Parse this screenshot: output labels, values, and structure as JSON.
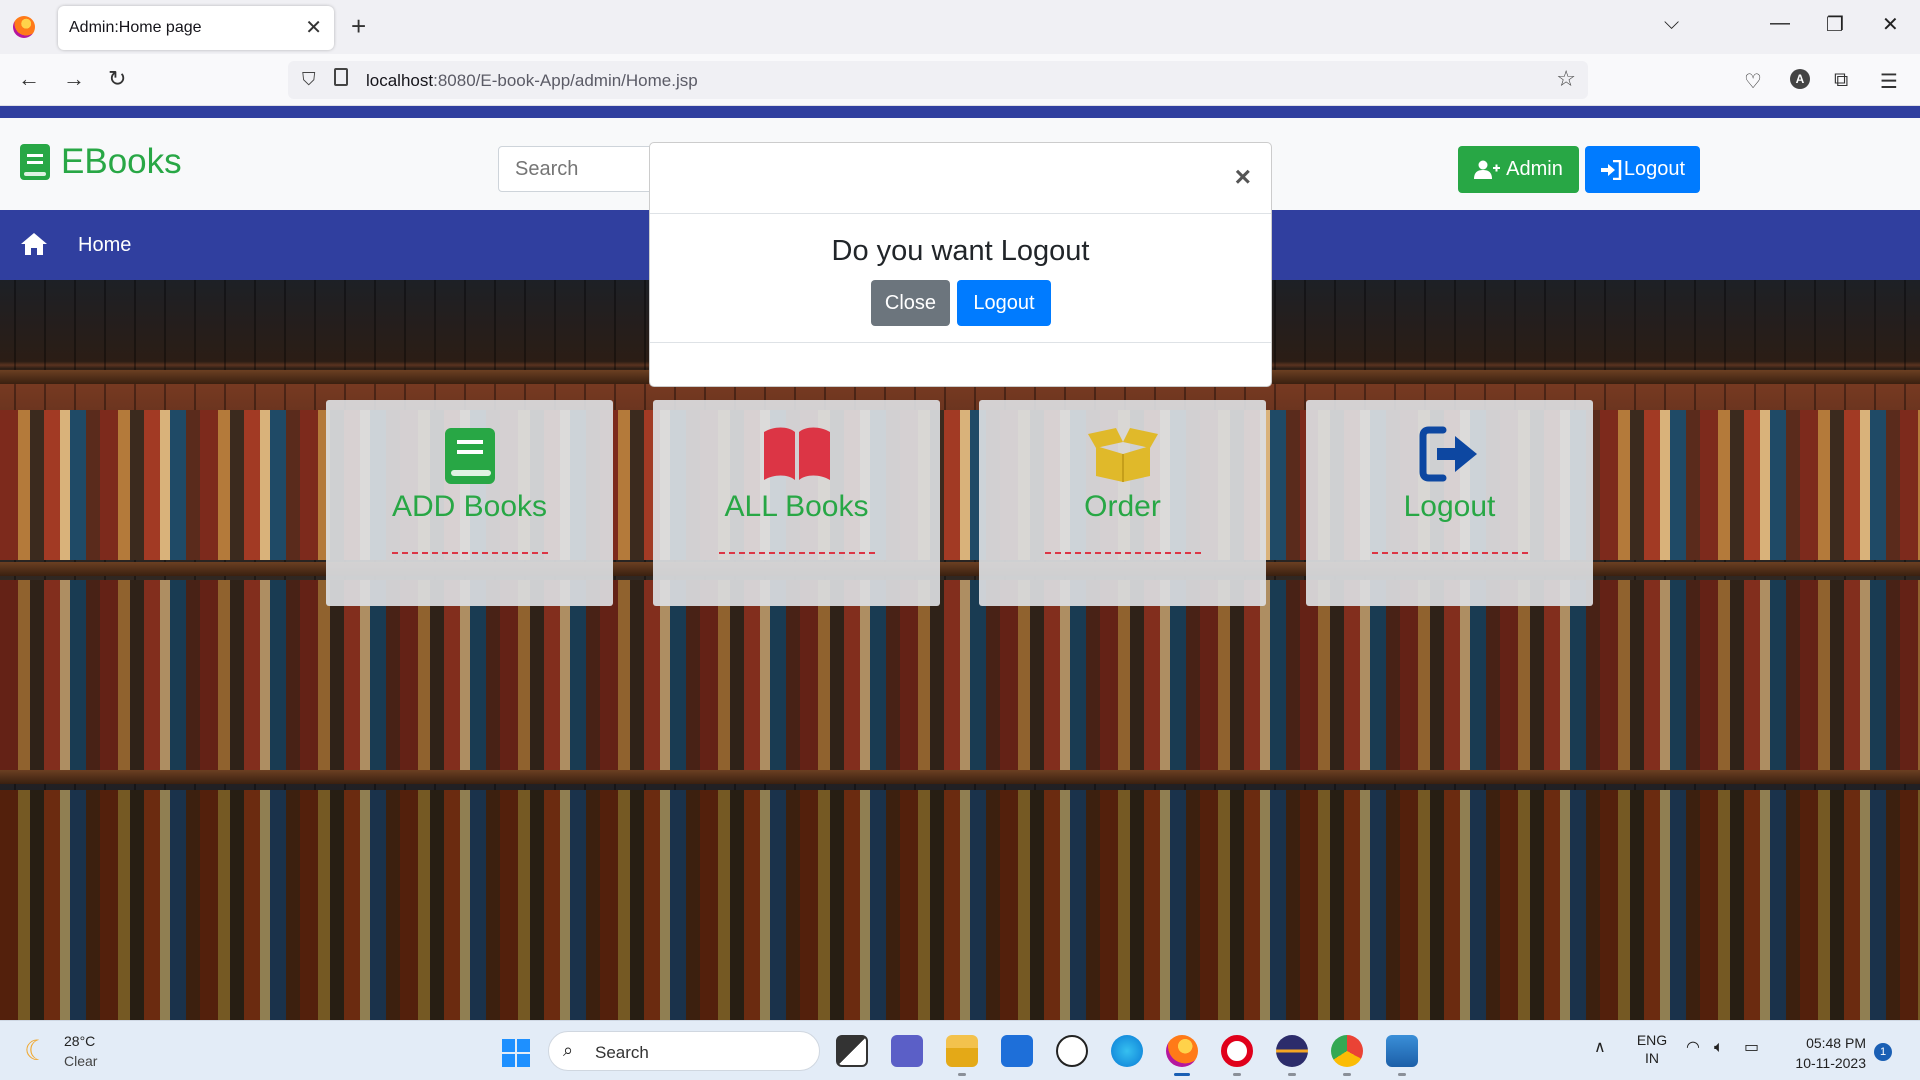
{
  "browser": {
    "tab_title": "Admin:Home page",
    "url_host": "localhost",
    "url_rest": ":8080/E-book-App/admin/Home.jsp"
  },
  "header": {
    "brand": "EBooks",
    "search_placeholder": "Search",
    "admin_button": "Admin",
    "logout_button": "Logout"
  },
  "nav": {
    "home_label": "Home"
  },
  "cards": [
    {
      "label": "ADD Books",
      "icon": "book-icon",
      "color": "#28a745"
    },
    {
      "label": "ALL Books",
      "icon": "open-book-icon",
      "color": "#dc3545"
    },
    {
      "label": "Order",
      "icon": "box-open-icon",
      "color": "#e0b92a"
    },
    {
      "label": "Logout",
      "icon": "sign-out-icon",
      "color": "#0d47a1"
    }
  ],
  "modal": {
    "close_x": "×",
    "message": "Do you want Logout",
    "close_button": "Close",
    "logout_button": "Logout"
  },
  "taskbar": {
    "weather_temp": "28°C",
    "weather_cond": "Clear",
    "search_label": "Search",
    "lang_top": "ENG",
    "lang_bottom": "IN",
    "time": "05:48 PM",
    "date": "10-11-2023",
    "notification_count": "1"
  },
  "colors": {
    "brand_green": "#28a745",
    "primary_blue": "#007bff",
    "nav_blue": "#303f9f",
    "secondary_gray": "#6c757d"
  }
}
